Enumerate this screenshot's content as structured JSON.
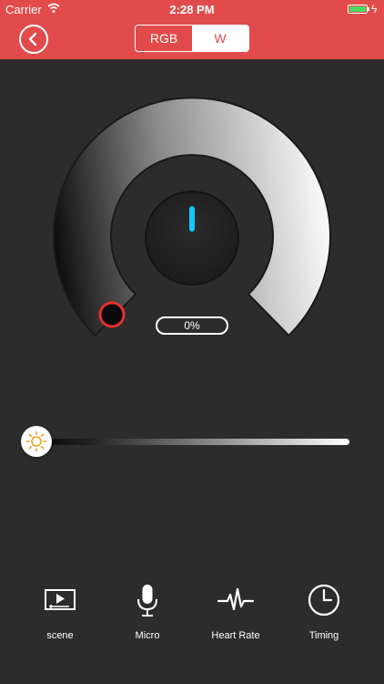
{
  "status_bar": {
    "carrier": "Carrier",
    "time": "2:28 PM",
    "battery_color": "#4cd964"
  },
  "nav": {
    "segments": [
      "RGB",
      "W"
    ],
    "selected_segment": "W",
    "accent": "#e24b4b"
  },
  "dial": {
    "percent_label": "0%",
    "level": 0
  },
  "brightness_slider": {
    "value": 0
  },
  "tabs": [
    {
      "label": "scene",
      "icon": "scene-icon"
    },
    {
      "label": "Micro",
      "icon": "microphone-icon"
    },
    {
      "label": "Heart Rate",
      "icon": "heart-rate-icon"
    },
    {
      "label": "Timing",
      "icon": "clock-icon"
    }
  ]
}
